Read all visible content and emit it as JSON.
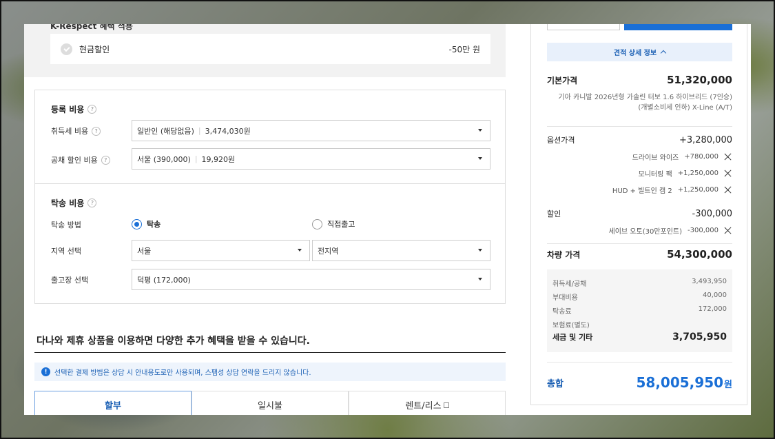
{
  "promo": {
    "title": "K-Respect 혜택 적용",
    "item_label": "현금할인",
    "item_amount": "-50만 원"
  },
  "registration": {
    "title": "등록 비용",
    "acq_tax_label": "취득세 비용",
    "acq_tax_select": "일반인 (해당없음)",
    "acq_tax_amount": "3,474,030원",
    "bond_label": "공채 할인 비용",
    "bond_select": "서울 (390,000)",
    "bond_amount": "19,920원"
  },
  "delivery": {
    "title": "탁송 비용",
    "method_label": "탁송 방법",
    "method_option_1": "탁송",
    "method_option_2": "직접출고",
    "selected_method": "탁송",
    "region_label": "지역 선택",
    "region_select": "서울",
    "district_select": "전지역",
    "depot_label": "출고장 선택",
    "depot_select": "덕평 (172,000)"
  },
  "partner": {
    "title": "다나와 제휴 상품을 이용하면 다양한 추가 혜택을 받을 수 있습니다.",
    "notice": "선택한 결제 방법은 상담 시 안내용도로만 사용되며, 스팸성 상담 연락을 드리지 않습니다.",
    "notice_icon": "info-icon",
    "tabs": [
      "할부",
      "일시불",
      "렌트/리스"
    ],
    "active_tab": "할부"
  },
  "summary": {
    "detail_button": "견적 상세 정보",
    "base_label": "기본가격",
    "base_value": "51,320,000",
    "model_line1": "기아 카니발 2026년형 가솔린 터보 1.6 하이브리드 (7인승)",
    "model_line2": "(개별소비세 인하) X-Line (A/T)",
    "option_label": "옵션가격",
    "option_value": "+3,280,000",
    "options": [
      {
        "name": "드라이브 와이즈",
        "amount": "+780,000"
      },
      {
        "name": "모니터링 팩",
        "amount": "+1,250,000"
      },
      {
        "name": "HUD + 빌트인 캠 2",
        "amount": "+1,250,000"
      }
    ],
    "discount_label": "할인",
    "discount_value": "-300,000",
    "discounts": [
      {
        "name": "세이브 오토(30만포인트)",
        "amount": "-300,000"
      }
    ],
    "car_price_label": "차량 가격",
    "car_price_value": "54,300,000",
    "tax": {
      "acq_label": "취득세/공채",
      "acq_value": "3,493,950",
      "extra_label": "부대비용",
      "extra_value": "40,000",
      "delivery_label": "탁송료",
      "delivery_value": "172,000",
      "insurance_label": "보험료(별도)",
      "total_label": "세금 및 기타",
      "total_value": "3,705,950"
    },
    "total_label": "총합",
    "total_value": "58,005,950",
    "total_unit": "원"
  },
  "colors": {
    "accent": "#1a6fd6",
    "accent_dark": "#1a5fb4",
    "notice_bg": "#eef4fc"
  }
}
